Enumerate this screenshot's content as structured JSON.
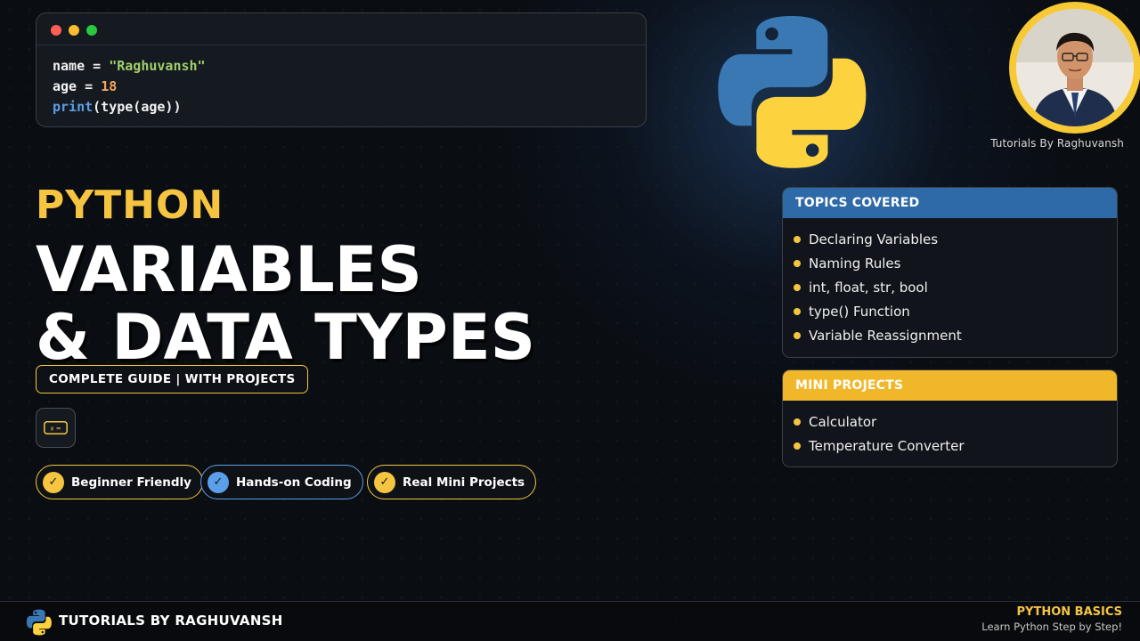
{
  "code": {
    "lines": [
      [
        {
          "t": "name = ",
          "c": "default"
        },
        {
          "t": "\"Raghuvansh\"",
          "c": "string"
        }
      ],
      [
        {
          "t": "age = ",
          "c": "default"
        },
        {
          "t": "18",
          "c": "number"
        }
      ],
      [
        {
          "t": "print",
          "c": "builtin"
        },
        {
          "t": "(type(age))",
          "c": "default"
        }
      ]
    ]
  },
  "channel_caption": "Tutorials By Raghuvansh",
  "headline": {
    "kicker": "PYTHON",
    "line1": "VARIABLES",
    "line2": "& DATA TYPES",
    "guide_label": "COMPLETE GUIDE | WITH PROJECTS",
    "var_icon_text": "x ="
  },
  "badges": [
    {
      "label": "Beginner Friendly",
      "style": "yellow"
    },
    {
      "label": "Hands-on Coding",
      "style": "blue"
    },
    {
      "label": "Real Mini Projects",
      "style": "yellow"
    }
  ],
  "topics": {
    "title": "TOPICS COVERED",
    "items": [
      "Declaring Variables",
      "Naming Rules",
      "int, float, str, bool",
      "type() Function",
      "Variable Reassignment"
    ]
  },
  "projects": {
    "title": "MINI PROJECTS",
    "items": [
      "Calculator",
      "Temperature Converter"
    ]
  },
  "footer": {
    "brand": "TUTORIALS BY RAGHUVANSH",
    "series": "PYTHON BASICS",
    "tagline": "Learn Python Step by Step!"
  },
  "colors": {
    "accent_yellow": "#f5c542",
    "accent_blue": "#2e6aa8",
    "python_blue": "#3776ab",
    "python_yellow": "#ffd343",
    "background": "#0a0d12"
  },
  "icons": [
    "python-logo",
    "check-icon",
    "variable-icon",
    "window-dots"
  ]
}
